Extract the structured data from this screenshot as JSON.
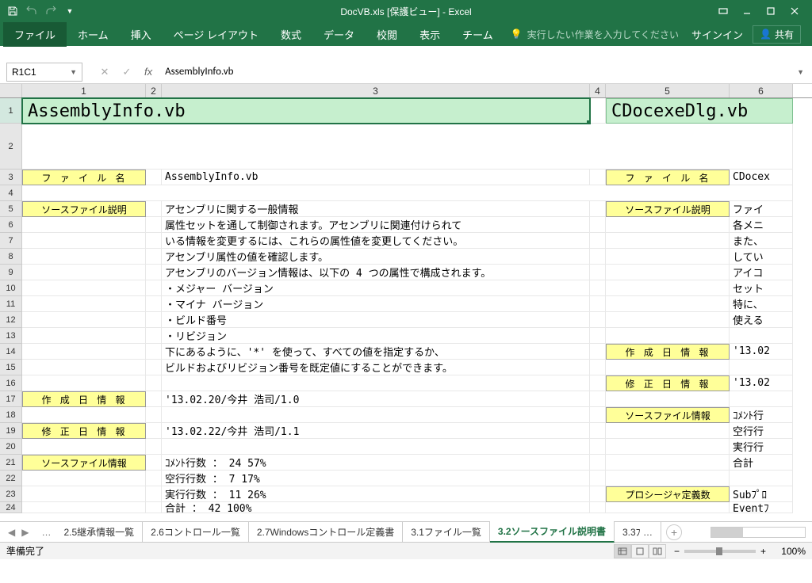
{
  "titlebar": {
    "title": "DocVB.xls [保護ビュー] - Excel"
  },
  "ribbon": {
    "tabs": {
      "file": "ファイル",
      "home": "ホーム",
      "insert": "挿入",
      "pagelayout": "ページ レイアウト",
      "formulas": "数式",
      "data": "データ",
      "review": "校閲",
      "view": "表示",
      "team": "チーム"
    },
    "tellme": "実行したい作業を入力してください",
    "signin": "サインイン",
    "share": "共有"
  },
  "namebox": {
    "ref": "R1C1",
    "formula": "AssemblyInfo.vb"
  },
  "colheaders": {
    "c1": "1",
    "c2": "2",
    "c3": "3",
    "c4": "4",
    "c5": "5",
    "c6": "6"
  },
  "sheet": {
    "r1": {
      "title_a": "AssemblyInfo.vb",
      "title_b": "CDocexeDlg.vb"
    },
    "labels": {
      "filename": "フ ァ イ ル 名",
      "srcdesc": "ソースファイル説明",
      "created": "作  成  日  情  報",
      "modified": "修  正  日  情  報",
      "srcinfo": "ソースファイル情報",
      "procdef": "プロシージャ定義数"
    },
    "r3": {
      "c3": "AssemblyInfo.vb",
      "c6": "CDocex"
    },
    "r5": {
      "c3": "アセンブリに関する一般情報",
      "c6": "ファイ"
    },
    "r6": {
      "c3": "属性セットを通して制御されます。アセンブリに関連付けられて",
      "c6": "各メニ"
    },
    "r7": {
      "c3": "いる情報を変更するには、これらの属性値を変更してください。",
      "c6": "また、"
    },
    "r8": {
      "c3": "アセンブリ属性の値を確認します。",
      "c6": "してい"
    },
    "r9": {
      "c3": "アセンブリのバージョン情報は、以下の 4 つの属性で構成されます。",
      "c6": "アイコ"
    },
    "r10": {
      "c3": "・メジャー バージョン",
      "c6": "セット"
    },
    "r11": {
      "c3": "・マイナ バージョン",
      "c6": "特に、"
    },
    "r12": {
      "c3": "・ビルド番号",
      "c6": "使える"
    },
    "r13": {
      "c3": "・リビジョン"
    },
    "r14": {
      "c3": "下にあるように、'*' を使って、すべての値を指定するか、",
      "c6": "'13.02"
    },
    "r15": {
      "c3": "ビルドおよびリビジョン番号を既定値にすることができます。"
    },
    "r16": {
      "c6": "'13.02"
    },
    "r17": {
      "c3": "'13.02.20/今井 浩司/1.0"
    },
    "r18": {
      "c6": "ｺﾒﾝﾄ行"
    },
    "r19": {
      "c3": "'13.02.22/今井 浩司/1.1",
      "c6": "空行行"
    },
    "r20": {
      "c6": "実行行"
    },
    "r21": {
      "c3": "ｺﾒﾝﾄ行数 ：     24     57%",
      "c6": "合計"
    },
    "r22": {
      "c3": "空行行数 ：      7     17%"
    },
    "r23": {
      "c3": "実行行数 ：     11     26%",
      "c6": "Subﾌﾟﾛ"
    },
    "r24": {
      "c3": "合計     ：     42    100%",
      "c6": "Eventﾌ"
    }
  },
  "tabs": {
    "t1": "2.5継承情報一覧",
    "t2": "2.6コントロール一覧",
    "t3": "2.7Windowsコントロール定義書",
    "t4": "3.1ファイル一覧",
    "t5": "3.2ソースファイル説明書",
    "t6": "3.3ﾌ …"
  },
  "status": {
    "ready": "準備完了",
    "zoom": "100%"
  }
}
